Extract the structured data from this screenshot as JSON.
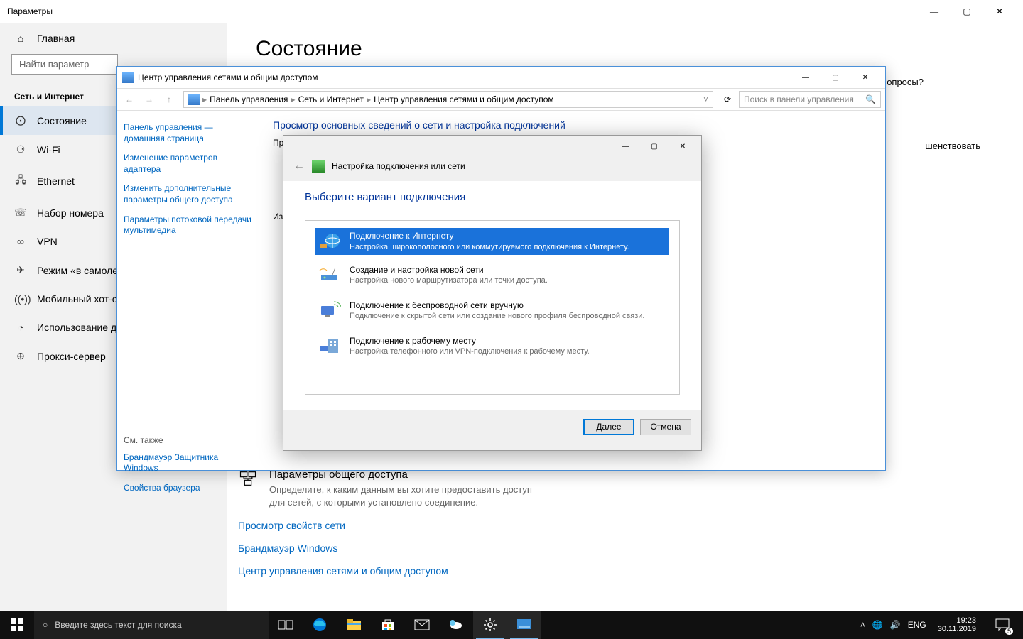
{
  "settings": {
    "window_title": "Параметры",
    "home": "Главная",
    "search_placeholder": "Найти параметр",
    "category": "Сеть и Интернет",
    "items": [
      {
        "label": "Состояние"
      },
      {
        "label": "Wi-Fi"
      },
      {
        "label": "Ethernet"
      },
      {
        "label": "Набор номера"
      },
      {
        "label": "VPN"
      },
      {
        "label": "Режим «в самолете»"
      },
      {
        "label": "Мобильный хот-спот"
      },
      {
        "label": "Использование данных"
      },
      {
        "label": "Прокси-сервер"
      }
    ],
    "page_heading": "Состояние",
    "help_question": "опросы?",
    "right_fragment": "шенствовать",
    "sharing": {
      "title": "Параметры общего доступа",
      "desc": "Определите, к каким данным вы хотите предоставить доступ для сетей, с которыми установлено соединение."
    },
    "links": {
      "view_props": "Просмотр свойств сети",
      "firewall": "Брандмауэр Windows",
      "center": "Центр управления сетями и общим доступом"
    }
  },
  "cp": {
    "title": "Центр управления сетями и общим доступом",
    "bc1": "Панель управления",
    "bc2": "Сеть и Интернет",
    "bc3": "Центр управления сетями и общим доступом",
    "search_placeholder": "Поиск в панели управления",
    "left": {
      "home": "Панель управления — домашняя страница",
      "adapter": "Изменение параметров адаптера",
      "sharing": "Изменить дополнительные параметры общего доступа",
      "stream": "Параметры потоковой передачи мультимедиа",
      "see_also": "См. также",
      "fw": "Брандмауэр Защитника Windows",
      "inet": "Свойства браузера"
    },
    "main_heading": "Просмотр основных сведений о сети и настройка подключений",
    "line1": "Про",
    "line2": "Изм"
  },
  "wiz": {
    "title": "Настройка подключения или сети",
    "heading": "Выберите вариант подключения",
    "options": [
      {
        "t1": "Подключение к Интернету",
        "t2": "Настройка широкополосного или коммутируемого подключения к Интернету."
      },
      {
        "t1": "Создание и настройка новой сети",
        "t2": "Настройка нового маршрутизатора или точки доступа."
      },
      {
        "t1": "Подключение к беспроводной сети вручную",
        "t2": "Подключение к скрытой сети или создание нового профиля беспроводной связи."
      },
      {
        "t1": "Подключение к рабочему месту",
        "t2": "Настройка телефонного или VPN-подключения к рабочему месту."
      }
    ],
    "next": "Далее",
    "cancel": "Отмена"
  },
  "taskbar": {
    "search_placeholder": "Введите здесь текст для поиска",
    "lang": "ENG",
    "time": "19:23",
    "date": "30.11.2019",
    "notif_count": "5"
  }
}
